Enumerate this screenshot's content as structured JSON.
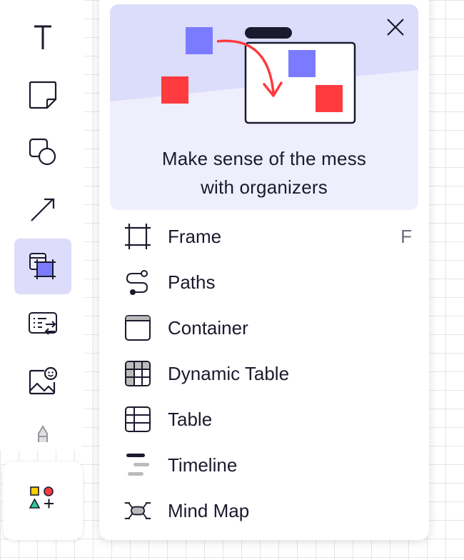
{
  "toolbar": {
    "tools": [
      {
        "name": "text-tool",
        "icon": "text-icon"
      },
      {
        "name": "sticky-note-tool",
        "icon": "sticky-note-icon"
      },
      {
        "name": "shapes-tool",
        "icon": "shapes-icon"
      },
      {
        "name": "connection-line-tool",
        "icon": "arrow-icon"
      },
      {
        "name": "organizers-tool",
        "icon": "frame-organizer-icon",
        "active": true
      },
      {
        "name": "cards-tool",
        "icon": "card-icon"
      },
      {
        "name": "media-tool",
        "icon": "image-sticker-icon"
      },
      {
        "name": "pen-tool",
        "icon": "pen-icon"
      }
    ],
    "more_tools_icon": "shapes-plus-icon"
  },
  "popup": {
    "hero": {
      "line1": "Make sense of the mess",
      "line2": "with organizers",
      "close_icon": "close-icon"
    },
    "items": [
      {
        "label": "Frame",
        "shortcut": "F",
        "icon": "frame-icon"
      },
      {
        "label": "Paths",
        "icon": "paths-icon"
      },
      {
        "label": "Container",
        "icon": "container-icon"
      },
      {
        "label": "Dynamic Table",
        "icon": "dynamic-table-icon"
      },
      {
        "label": "Table",
        "icon": "table-icon"
      },
      {
        "label": "Timeline",
        "icon": "timeline-icon"
      },
      {
        "label": "Mind Map",
        "icon": "mind-map-icon"
      }
    ]
  },
  "colors": {
    "accent_purple": "#7b7bff",
    "accent_red": "#ff3b3f",
    "active_bg": "#dedcfb",
    "hero_bg": "#efeefc",
    "hero_band": "#dcdcfb",
    "text": "#1a1a2e"
  }
}
